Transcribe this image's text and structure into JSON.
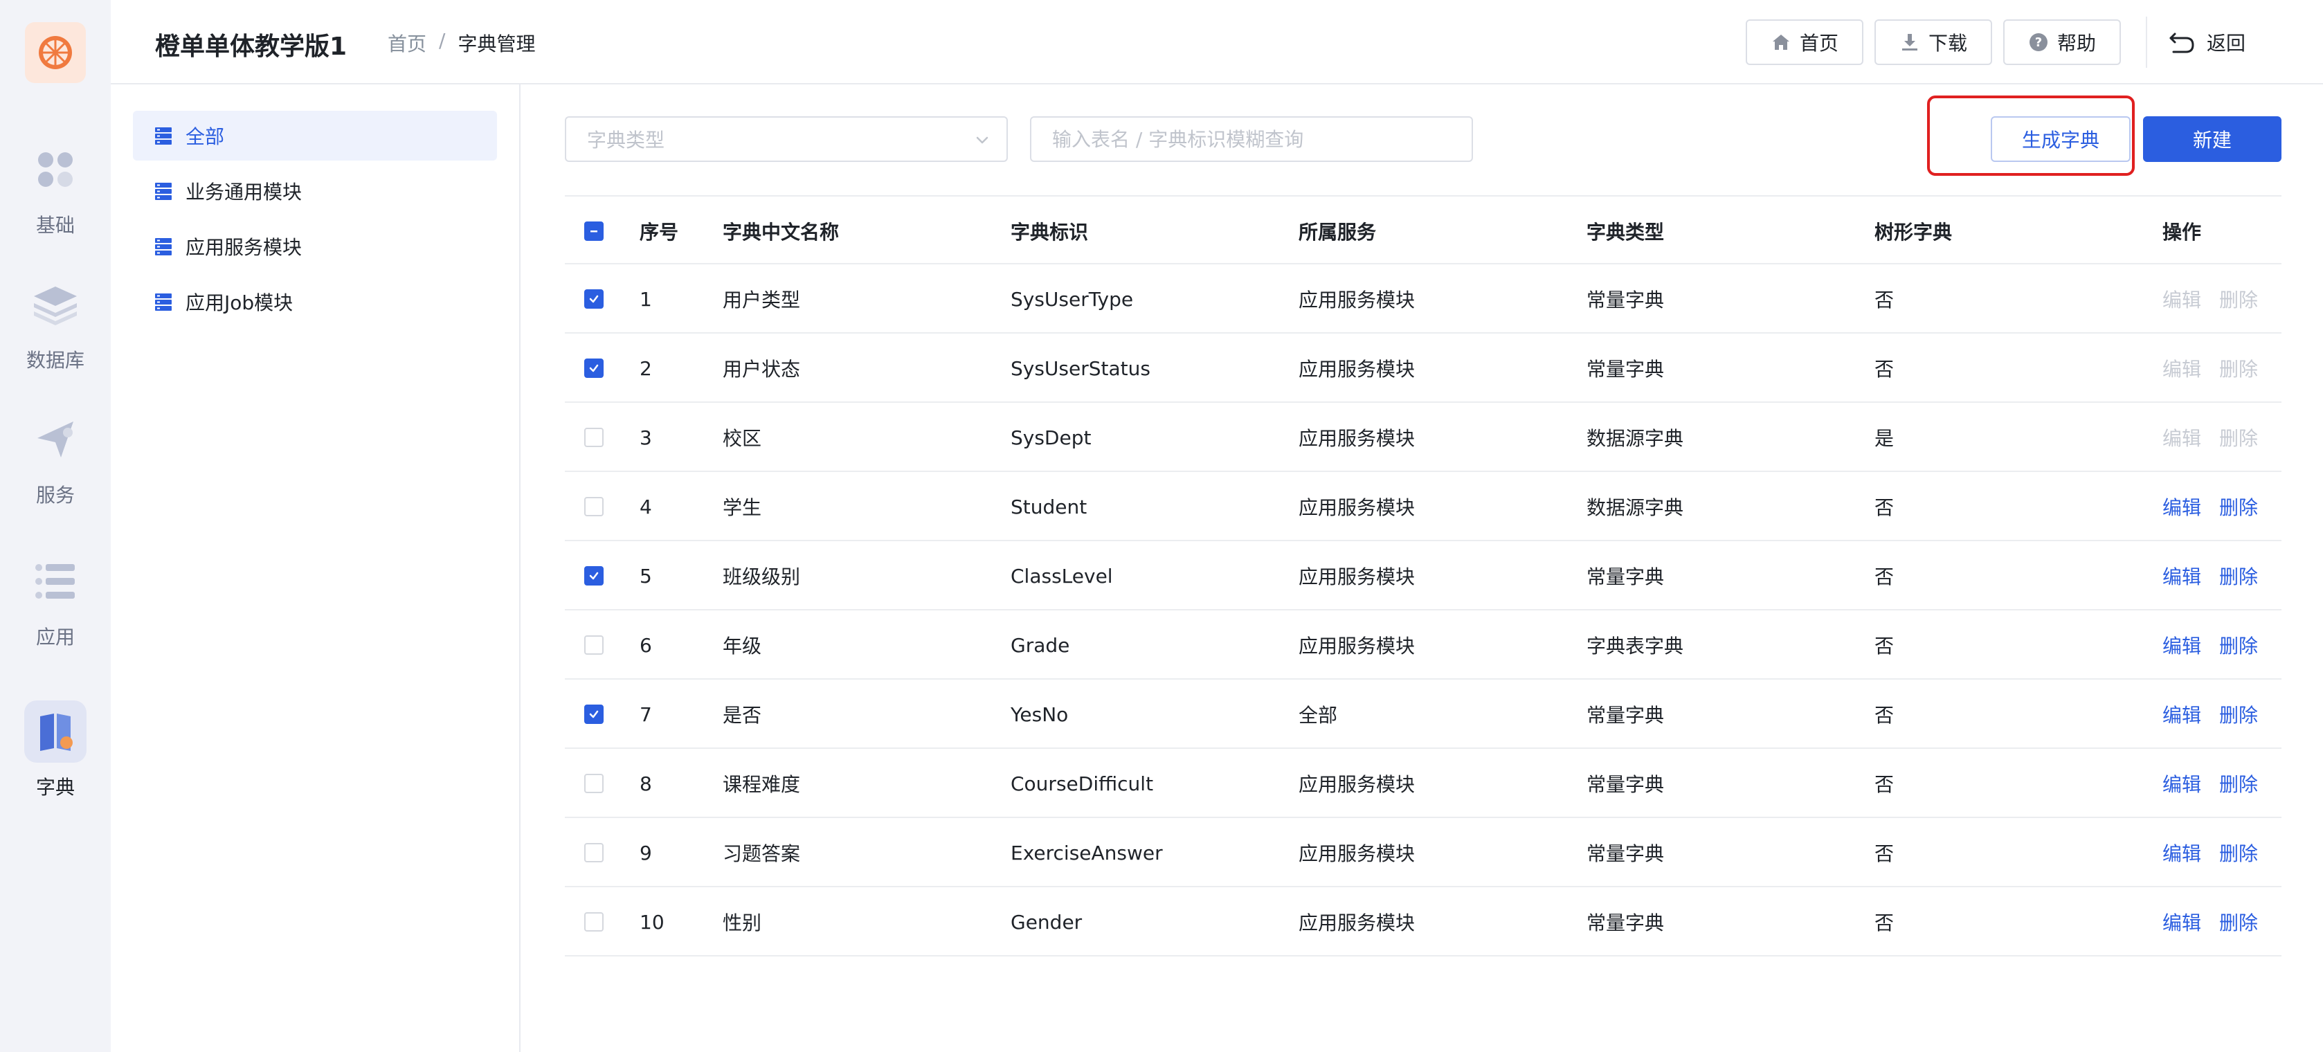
{
  "colors": {
    "accent": "#2b5ee0",
    "highlight": "#e02020",
    "logo": "#f07a3f"
  },
  "sidebar": {
    "items": [
      {
        "label": "基础",
        "icon": "grid-icon"
      },
      {
        "label": "数据库",
        "icon": "layers-icon"
      },
      {
        "label": "服务",
        "icon": "send-icon"
      },
      {
        "label": "应用",
        "icon": "list-icon"
      },
      {
        "label": "字典",
        "icon": "book-icon",
        "active": true
      }
    ]
  },
  "header": {
    "title": "橙单单体教学版1",
    "breadcrumb": {
      "home": "首页",
      "separator": "/",
      "current": "字典管理"
    },
    "buttons": {
      "home": "首页",
      "download": "下载",
      "help": "帮助"
    },
    "back": "返回"
  },
  "categories": [
    {
      "label": "全部",
      "active": true
    },
    {
      "label": "业务通用模块"
    },
    {
      "label": "应用服务模块"
    },
    {
      "label": "应用Job模块"
    }
  ],
  "filters": {
    "type_placeholder": "字典类型",
    "search_placeholder": "输入表名 / 字典标识模糊查询"
  },
  "actions": {
    "generate": "生成字典",
    "create": "新建"
  },
  "table": {
    "columns": [
      "序号",
      "字典中文名称",
      "字典标识",
      "所属服务",
      "字典类型",
      "树形字典",
      "操作"
    ],
    "edit_label": "编辑",
    "delete_label": "删除",
    "rows": [
      {
        "no": "1",
        "name": "用户类型",
        "code": "SysUserType",
        "service": "应用服务模块",
        "type": "常量字典",
        "tree": "否",
        "checked": true,
        "editable": false
      },
      {
        "no": "2",
        "name": "用户状态",
        "code": "SysUserStatus",
        "service": "应用服务模块",
        "type": "常量字典",
        "tree": "否",
        "checked": true,
        "editable": false
      },
      {
        "no": "3",
        "name": "校区",
        "code": "SysDept",
        "service": "应用服务模块",
        "type": "数据源字典",
        "tree": "是",
        "checked": false,
        "editable": false
      },
      {
        "no": "4",
        "name": "学生",
        "code": "Student",
        "service": "应用服务模块",
        "type": "数据源字典",
        "tree": "否",
        "checked": false,
        "editable": true
      },
      {
        "no": "5",
        "name": "班级级别",
        "code": "ClassLevel",
        "service": "应用服务模块",
        "type": "常量字典",
        "tree": "否",
        "checked": true,
        "editable": true
      },
      {
        "no": "6",
        "name": "年级",
        "code": "Grade",
        "service": "应用服务模块",
        "type": "字典表字典",
        "tree": "否",
        "checked": false,
        "editable": true
      },
      {
        "no": "7",
        "name": "是否",
        "code": "YesNo",
        "service": "全部",
        "type": "常量字典",
        "tree": "否",
        "checked": true,
        "editable": true
      },
      {
        "no": "8",
        "name": "课程难度",
        "code": "CourseDifficult",
        "service": "应用服务模块",
        "type": "常量字典",
        "tree": "否",
        "checked": false,
        "editable": true
      },
      {
        "no": "9",
        "name": "习题答案",
        "code": "ExerciseAnswer",
        "service": "应用服务模块",
        "type": "常量字典",
        "tree": "否",
        "checked": false,
        "editable": true
      },
      {
        "no": "10",
        "name": "性别",
        "code": "Gender",
        "service": "应用服务模块",
        "type": "常量字典",
        "tree": "否",
        "checked": false,
        "editable": true
      }
    ]
  }
}
